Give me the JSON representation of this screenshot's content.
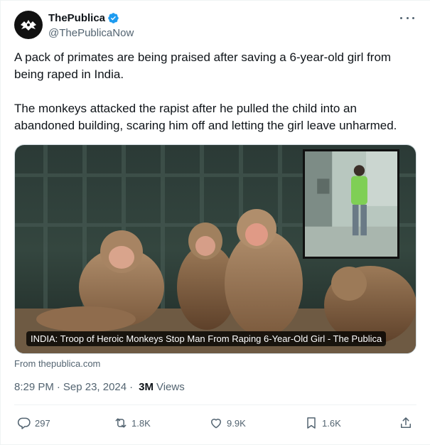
{
  "author": {
    "display_name": "ThePublica",
    "handle": "@ThePublicaNow",
    "verified": true
  },
  "tweet": {
    "paragraphs": [
      "A pack of primates are being praised after saving a 6-year-old girl from being raped in India.",
      "The monkeys attacked the rapist after he pulled the child into an abandoned building, scaring him off and letting the girl leave unharmed."
    ],
    "media_caption": "INDIA: Troop of Heroic Monkeys Stop Man From Raping 6-Year-Old Girl - The Publica",
    "link_source": "From thepublica.com"
  },
  "meta": {
    "time": "8:29 PM",
    "date": "Sep 23, 2024",
    "separator": "·",
    "views_count": "3M",
    "views_label": "Views"
  },
  "actions": {
    "replies": "297",
    "reposts": "1.8K",
    "likes": "9.9K",
    "bookmarks": "1.6K"
  },
  "colors": {
    "text": "#0f1419",
    "secondary": "#536471",
    "verified": "#1d9bf0",
    "divider": "#eff3f4"
  },
  "icons": [
    "more-icon",
    "verified-icon",
    "reply-icon",
    "repost-icon",
    "like-icon",
    "bookmark-icon",
    "share-icon"
  ]
}
